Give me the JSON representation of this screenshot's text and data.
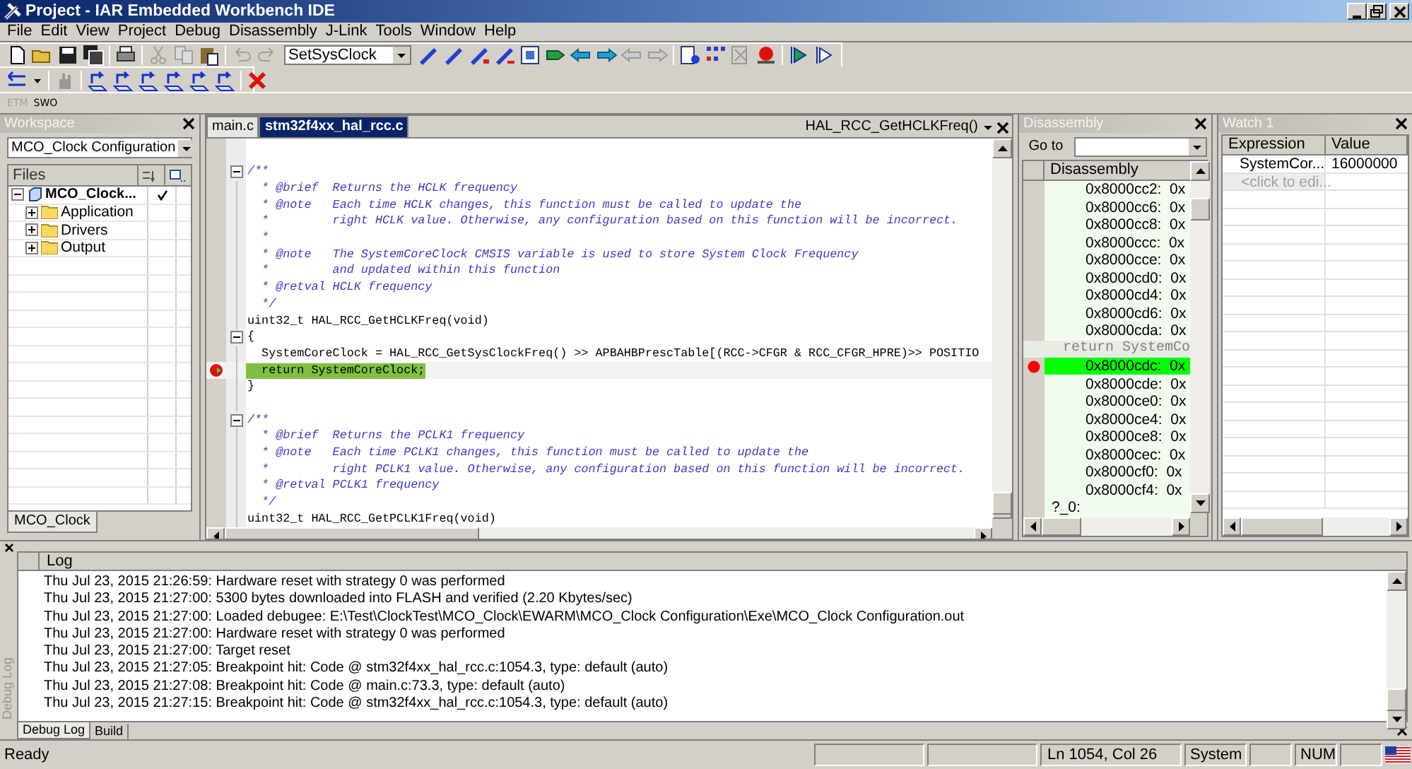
{
  "window": {
    "title": "Project - IAR Embedded Workbench IDE"
  },
  "menu": [
    "File",
    "Edit",
    "View",
    "Project",
    "Debug",
    "Disassembly",
    "J-Link",
    "Tools",
    "Window",
    "Help"
  ],
  "toolbar": {
    "function_combo": "SetSysClock"
  },
  "trace_toolbar": [
    {
      "label": "ETM",
      "disabled": true
    },
    {
      "label": "SWO",
      "disabled": false
    }
  ],
  "workspace": {
    "title": "Workspace",
    "configuration": "MCO_Clock Configuration",
    "files_header": "Files",
    "tab": "MCO_Clock",
    "tree": [
      {
        "label": "MCO_Clock...",
        "expanded": true,
        "children": [
          {
            "label": "Application",
            "expanded": false
          },
          {
            "label": "Drivers",
            "expanded": false
          },
          {
            "label": "Output",
            "expanded": false
          }
        ]
      }
    ]
  },
  "editor": {
    "tabs": [
      {
        "label": "main.c",
        "selected": false
      },
      {
        "label": "stm32f4xx_hal_rcc.c",
        "selected": true
      }
    ],
    "function": "HAL_RCC_GetHCLKFreq()",
    "lines": [
      {
        "text": "/**",
        "kind": "comment",
        "fold": true,
        "current": false
      },
      {
        "text": "  * @brief  Returns the HCLK frequency",
        "kind": "comment",
        "fold": false,
        "current": false
      },
      {
        "text": "  * @note   Each time HCLK changes, this function must be called to update the",
        "kind": "comment",
        "fold": false,
        "current": false
      },
      {
        "text": "  *         right HCLK value. Otherwise, any configuration based on this function will be incorrect.",
        "kind": "comment",
        "fold": false,
        "current": false
      },
      {
        "text": "  *",
        "kind": "comment",
        "fold": false,
        "current": false
      },
      {
        "text": "  * @note   The SystemCoreClock CMSIS variable is used to store System Clock Frequency",
        "kind": "comment",
        "fold": false,
        "current": false
      },
      {
        "text": "  *         and updated within this function",
        "kind": "comment",
        "fold": false,
        "current": false
      },
      {
        "text": "  * @retval HCLK frequency",
        "kind": "comment",
        "fold": false,
        "current": false
      },
      {
        "text": "  */",
        "kind": "comment",
        "fold": false,
        "current": false
      },
      {
        "text": "uint32_t HAL_RCC_GetHCLKFreq(void)",
        "kind": "code",
        "fold": false,
        "current": false
      },
      {
        "text": "{",
        "kind": "code",
        "fold": true,
        "current": false
      },
      {
        "text": "  SystemCoreClock = HAL_RCC_GetSysClockFreq() >> APBAHBPrescTable[(RCC->CFGR & RCC_CFGR_HPRE)>> POSITIO",
        "kind": "code",
        "fold": false,
        "current": false
      },
      {
        "text": "  return SystemCoreClock;",
        "kind": "code",
        "fold": false,
        "current": true
      },
      {
        "text": "}",
        "kind": "code",
        "fold": false,
        "current": false
      },
      {
        "kind": "blank",
        "fold": false,
        "current": false
      },
      {
        "text": "/**",
        "kind": "comment",
        "fold": true,
        "current": false
      },
      {
        "text": "  * @brief  Returns the PCLK1 frequency",
        "kind": "comment",
        "fold": false,
        "current": false
      },
      {
        "text": "  * @note   Each time PCLK1 changes, this function must be called to update the",
        "kind": "comment",
        "fold": false,
        "current": false
      },
      {
        "text": "  *         right PCLK1 value. Otherwise, any configuration based on this function will be incorrect.",
        "kind": "comment",
        "fold": false,
        "current": false
      },
      {
        "text": "  * @retval PCLK1 frequency",
        "kind": "comment",
        "fold": false,
        "current": false
      },
      {
        "text": "  */",
        "kind": "comment",
        "fold": false,
        "current": false
      },
      {
        "text": "uint32_t HAL_RCC_GetPCLK1Freq(void)",
        "kind": "code",
        "fold": false,
        "current": false
      }
    ]
  },
  "disassembly": {
    "title": "Disassembly",
    "goto_label": "Go to",
    "column": "Disassembly",
    "rows": [
      {
        "text": "0x8000cc2:  0x",
        "kind": "instr",
        "current": false
      },
      {
        "text": "0x8000cc6:  0x",
        "kind": "instr",
        "current": false
      },
      {
        "text": "0x8000cc8:  0x",
        "kind": "instr",
        "current": false
      },
      {
        "text": "0x8000ccc:  0x",
        "kind": "instr",
        "current": false
      },
      {
        "text": "0x8000cce:  0x",
        "kind": "instr",
        "current": false
      },
      {
        "text": "0x8000cd0:  0x",
        "kind": "instr",
        "current": false
      },
      {
        "text": "0x8000cd4:  0x",
        "kind": "instr",
        "current": false
      },
      {
        "text": "0x8000cd6:  0x",
        "kind": "instr",
        "current": false
      },
      {
        "text": "0x8000cda:  0x",
        "kind": "instr",
        "current": false
      },
      {
        "text": "return SystemCo",
        "kind": "source",
        "current": false
      },
      {
        "text": "0x8000cdc:  0x",
        "kind": "instr",
        "current": true
      },
      {
        "text": "0x8000cde:  0x",
        "kind": "instr",
        "current": false
      },
      {
        "text": "0x8000ce0:  0x",
        "kind": "instr",
        "current": false
      },
      {
        "text": "0x8000ce4:  0x",
        "kind": "instr",
        "current": false
      },
      {
        "text": "0x8000ce8:  0x",
        "kind": "instr",
        "current": false
      },
      {
        "text": "0x8000cec:  0x",
        "kind": "instr",
        "current": false
      },
      {
        "text": "0x8000cf0:  0x",
        "kind": "instr",
        "current": false
      },
      {
        "text": "0x8000cf4:  0x",
        "kind": "instr",
        "current": false
      },
      {
        "text": "?_0:",
        "kind": "label",
        "current": false
      }
    ]
  },
  "watch": {
    "title": "Watch 1",
    "columns": [
      "Expression",
      "Value"
    ],
    "rows": [
      {
        "expression": "SystemCor...",
        "value": "16000000",
        "kind": "entry"
      },
      {
        "expression": "<click to edi...",
        "kind": "placeholder"
      }
    ]
  },
  "log": {
    "side_label": "Debug Log",
    "column": "Log",
    "lines": [
      "Thu Jul 23, 2015 21:26:59: Hardware reset with strategy 0 was performed",
      "Thu Jul 23, 2015 21:27:00: 5300 bytes downloaded into FLASH and verified (2.20 Kbytes/sec)",
      "Thu Jul 23, 2015 21:27:00: Loaded debugee: E:\\Test\\ClockTest\\MCO_Clock\\EWARM\\MCO_Clock Configuration\\Exe\\MCO_Clock Configuration.out",
      "Thu Jul 23, 2015 21:27:00: Hardware reset with strategy 0 was performed",
      "Thu Jul 23, 2015 21:27:00: Target reset",
      "Thu Jul 23, 2015 21:27:05: Breakpoint hit: Code @ stm32f4xx_hal_rcc.c:1054.3, type: default (auto)",
      "Thu Jul 23, 2015 21:27:08: Breakpoint hit: Code @ main.c:73.3, type: default (auto)",
      "Thu Jul 23, 2015 21:27:15: Breakpoint hit: Code @ stm32f4xx_hal_rcc.c:1054.3, type: default (auto)"
    ],
    "tabs": [
      {
        "label": "Debug Log",
        "selected": true
      },
      {
        "label": "Build",
        "selected": false
      }
    ]
  },
  "status_bar": {
    "message": "Ready",
    "position": "Ln 1054, Col 26",
    "mode": "System",
    "num": "NUM"
  }
}
